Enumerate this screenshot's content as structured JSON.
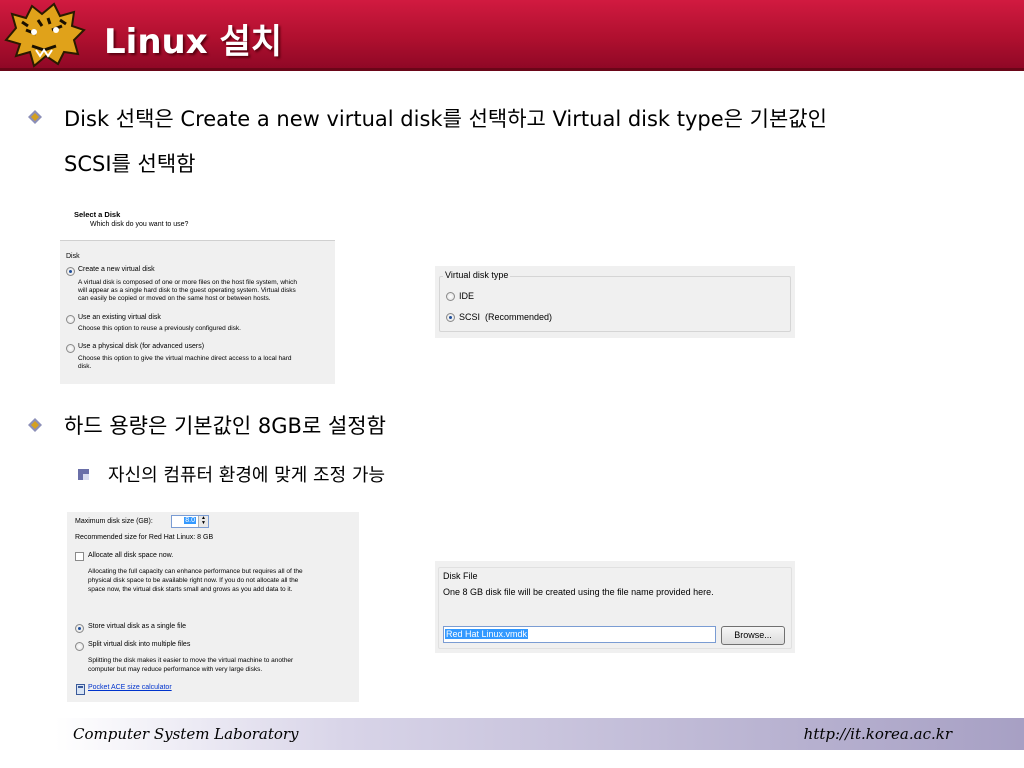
{
  "header": {
    "title": "Linux 설치"
  },
  "bullets": [
    {
      "line1": "Disk 선택은 Create a new virtual disk를 선택하고 Virtual disk type은 기본값인",
      "line2": "SCSI를 선택함"
    },
    {
      "line1": "하드 용량은 기본값인 8GB로 설정함"
    }
  ],
  "sub_bullets": [
    {
      "text": "자신의 컴퓨터 환경에 맞게 조정 가능"
    }
  ],
  "select_disk": {
    "heading": "Select a Disk",
    "subheading": "Which disk do you want to use?",
    "group": "Disk",
    "options": [
      {
        "label": "Create a new virtual disk",
        "selected": true,
        "desc": [
          "A virtual disk is composed of one or more files on the host file system, which",
          "will appear as a single hard disk to the guest operating system. Virtual disks",
          "can easily be copied or moved on the same host or between hosts."
        ]
      },
      {
        "label": "Use an existing virtual disk",
        "selected": false,
        "desc": [
          "Choose this option to reuse a previously configured disk."
        ]
      },
      {
        "label": "Use a physical disk (for advanced users)",
        "selected": false,
        "desc": [
          "Choose this option to give the virtual machine direct access to a local hard",
          "disk."
        ]
      }
    ]
  },
  "disk_type": {
    "group": "Virtual disk type",
    "options": [
      {
        "label": "IDE",
        "selected": false
      },
      {
        "label": "SCSI",
        "note": "(Recommended)",
        "selected": true
      }
    ]
  },
  "disk_capacity": {
    "max_size_label": "Maximum disk size (GB):",
    "max_size_value": "8.0",
    "recommended": "Recommended size for Red Hat Linux: 8 GB",
    "allocate_label": "Allocate all disk space now.",
    "allocate_checked": false,
    "allocate_desc": [
      "Allocating the full capacity can enhance performance but requires all of the",
      "physical disk space to be available right now. If you do not allocate all the",
      "space now, the virtual disk starts small and grows as you add data to it."
    ],
    "store_single": "Store virtual disk as a single file",
    "split_multiple": "Split virtual disk into multiple files",
    "split_desc": [
      "Splitting the disk makes it easier to move the virtual machine to another",
      "computer but may reduce performance with very large disks."
    ],
    "calculator_link": "Pocket ACE size calculator"
  },
  "disk_file": {
    "group": "Disk File",
    "description": "One 8 GB disk file will be created using the file name provided here.",
    "filename": "Red Hat Linux.vmdk",
    "browse_label": "Browse..."
  },
  "footer": {
    "lab": "Computer System Laboratory",
    "url": "http://it.korea.ac.kr"
  },
  "colors": {
    "header_red": "#b0102f",
    "footer_purple": "#a7a0c4",
    "selection_blue": "#3399ff"
  }
}
